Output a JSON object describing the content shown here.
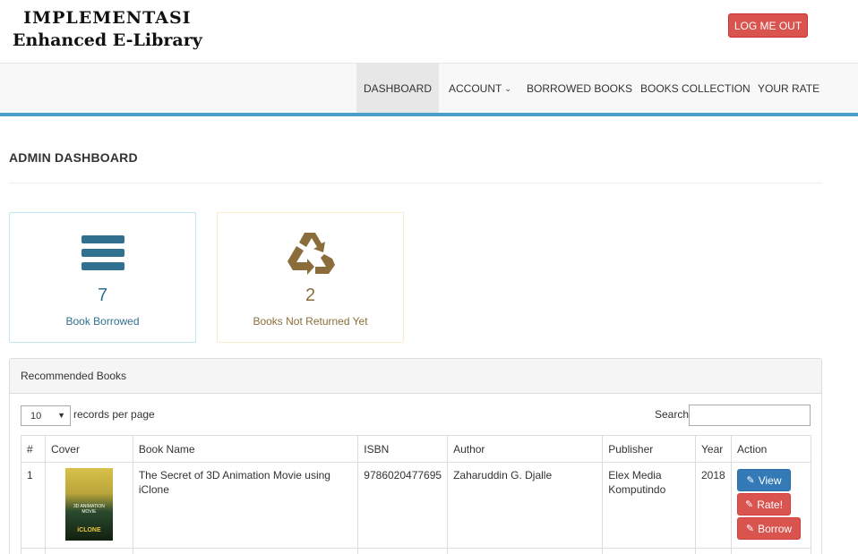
{
  "header": {
    "logo_line1": "IMPLEMENTASI",
    "logo_line2": "Enhanced E-Library",
    "logout_label": "LOG ME OUT"
  },
  "nav": {
    "items": [
      {
        "label": "DASHBOARD",
        "active": true
      },
      {
        "label": "ACCOUNT",
        "dropdown": true
      },
      {
        "label": "BORROWED BOOKS"
      },
      {
        "label": "BOOKS COLLECTION"
      },
      {
        "label": "YOUR RATE"
      }
    ],
    "accent_color": "#4a9fc4"
  },
  "page": {
    "title": "ADMIN DASHBOARD"
  },
  "stats": [
    {
      "value": "7",
      "label": "Book Borrowed",
      "icon": "bars-icon",
      "color": "#31708f"
    },
    {
      "value": "2",
      "label": "Books Not Returned Yet",
      "icon": "recycle-icon",
      "color": "#8a6d3b"
    }
  ],
  "recommended": {
    "heading": "Recommended Books",
    "page_length": "10",
    "records_label": "records per page",
    "search_label": "Search:",
    "search_value": "",
    "columns": [
      "#",
      "Cover",
      "Book Name",
      "ISBN",
      "Author",
      "Publisher",
      "Year",
      "Action"
    ],
    "rows": [
      {
        "no": "1",
        "cover_title": "3D ANIMATION MOVIE",
        "cover_brand": "iCLONE",
        "book_name": "The Secret of 3D Animation Movie using iClone",
        "isbn": "9786020477695",
        "author": "Zaharuddin G. Djalle",
        "publisher": "Elex Media Komputindo",
        "year": "2018",
        "actions": {
          "view": "View",
          "rate": "Rate!",
          "borrow": "Borrow"
        }
      }
    ]
  }
}
